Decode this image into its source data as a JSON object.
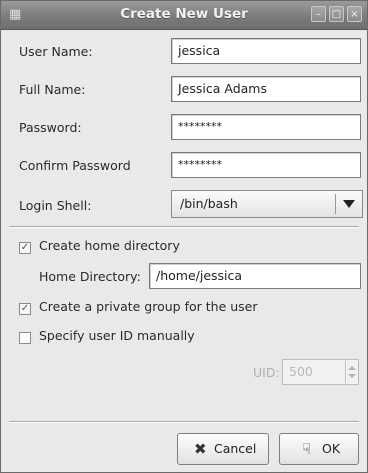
{
  "window": {
    "title": "Create New User",
    "icon": "user-icon",
    "controls": [
      "minimize-icon",
      "maximize-icon",
      "close-icon"
    ]
  },
  "form": {
    "user_name": {
      "label": "User Name:",
      "value": "jessica"
    },
    "full_name": {
      "label": "Full Name:",
      "value": "Jessica Adams"
    },
    "password": {
      "label": "Password:",
      "value": "********"
    },
    "confirm_password": {
      "label": "Confirm Password",
      "value": "********"
    },
    "login_shell": {
      "label": "Login Shell:",
      "value": "/bin/bash"
    }
  },
  "options": {
    "create_home": {
      "label": "Create home directory",
      "checked": true
    },
    "home_directory": {
      "label": "Home Directory:",
      "value": "/home/jessica"
    },
    "private_group": {
      "label": "Create a private group for the user",
      "checked": true
    },
    "specify_uid": {
      "label": "Specify user ID manually",
      "checked": false
    },
    "uid": {
      "label": "UID:",
      "value": "500",
      "enabled": false
    }
  },
  "buttons": {
    "cancel": {
      "label": "Cancel",
      "icon": "cancel-x-icon"
    },
    "ok": {
      "label": "OK",
      "icon": "ok-hand-icon"
    }
  },
  "colors": {
    "titlebar": "#7c7c7c",
    "window_bg": "#e9e9e9"
  }
}
